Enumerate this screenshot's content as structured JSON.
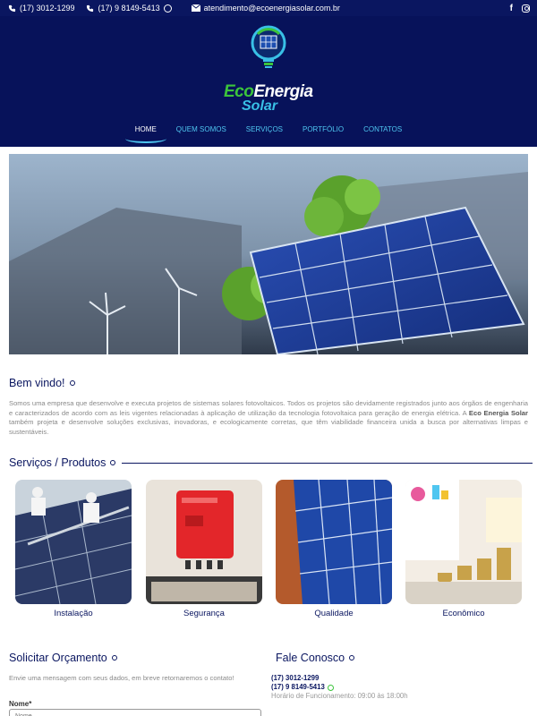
{
  "topbar": {
    "phone1": "(17) 3012-1299",
    "phone2": "(17) 9 8149-5413",
    "email": "atendimento@ecoenergiasolar.com.br",
    "icons": [
      "phone-icon",
      "phone-icon",
      "whatsapp-icon",
      "mail-icon",
      "facebook-icon",
      "instagram-icon"
    ],
    "facebook_glyph": "f"
  },
  "logo": {
    "word1": "Eco",
    "word2": "Energia",
    "word3": "Solar"
  },
  "nav": {
    "items": [
      {
        "label": "HOME",
        "active": true
      },
      {
        "label": "QUEM SOMOS",
        "active": false
      },
      {
        "label": "SERVIÇOS",
        "active": false
      },
      {
        "label": "PORTFÓLIO",
        "active": false
      },
      {
        "label": "CONTATOS",
        "active": false
      }
    ]
  },
  "welcome": {
    "title": "Bem vindo!",
    "text_part1": "Somos uma empresa que desenvolve e executa projetos de sistemas solares fotovoltaicos. Todos os projetos são devidamente registrados junto aos órgãos de engenharia e caracterizados de acordo com as leis vigentes relacionadas à aplicação de utilização da tecnologia fotovoltaica para geração de energia elétrica. A ",
    "text_bold": "Eco Energia Solar",
    "text_part2": " também projeta e desenvolve soluções exclusivas, inovadoras, e ecologicamente corretas, que têm viabilidade financeira unida a busca por alternativas limpas e sustentáveis."
  },
  "services": {
    "title": "Serviços / Produtos",
    "cards": [
      {
        "label": "Instalação"
      },
      {
        "label": "Segurança"
      },
      {
        "label": "Qualidade"
      },
      {
        "label": "Econômico"
      }
    ]
  },
  "quote": {
    "title": "Solicitar Orçamento",
    "subtitle": "Envie uma mensagem com seus dados, em breve retornaremos o contato!",
    "name_label": "Nome*",
    "name_placeholder": "Nome"
  },
  "contact": {
    "title": "Fale Conosco",
    "phone1": "(17) 3012-1299",
    "phone2": "(17) 9 8149-5413",
    "hours": "Horário de Funcionamento: 09:00 às 18:00h"
  },
  "colors": {
    "navy": "#0a1660",
    "accent": "#4fc6f0",
    "green": "#3cc43c"
  }
}
